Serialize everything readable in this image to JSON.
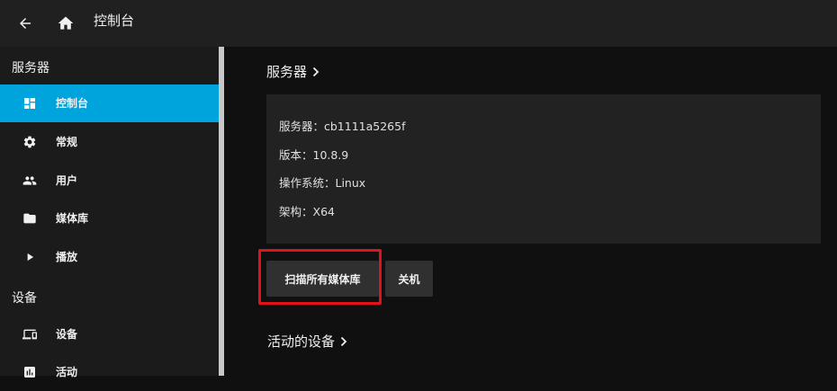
{
  "header": {
    "title": "控制台",
    "back_icon": "back-arrow-icon",
    "home_icon": "home-icon"
  },
  "sidebar": {
    "sections": [
      {
        "label": "服务器",
        "items": [
          {
            "label": "控制台",
            "icon": "dashboard-icon",
            "active": true
          },
          {
            "label": "常规",
            "icon": "gear-icon"
          },
          {
            "label": "用户",
            "icon": "people-icon"
          },
          {
            "label": "媒体库",
            "icon": "folder-icon"
          },
          {
            "label": "播放",
            "icon": "play-icon"
          }
        ]
      },
      {
        "label": "设备",
        "items": [
          {
            "label": "设备",
            "icon": "devices-icon"
          },
          {
            "label": "活动",
            "icon": "activity-icon"
          }
        ]
      }
    ]
  },
  "main": {
    "server_section_title": "服务器",
    "server_info": [
      "服务器：cb1111a5265f",
      "版本：10.8.9",
      "操作系统：Linux",
      "架构：X64"
    ],
    "scan_button": "扫描所有媒体库",
    "shutdown_button": "关机",
    "active_devices_title": "活动的设备"
  },
  "colors": {
    "accent": "#00a4dc",
    "highlight": "#e0121c",
    "header_bg": "#202020",
    "sidebar_bg": "#1b1b1b",
    "card_bg": "#222222",
    "page_bg": "#101010"
  }
}
